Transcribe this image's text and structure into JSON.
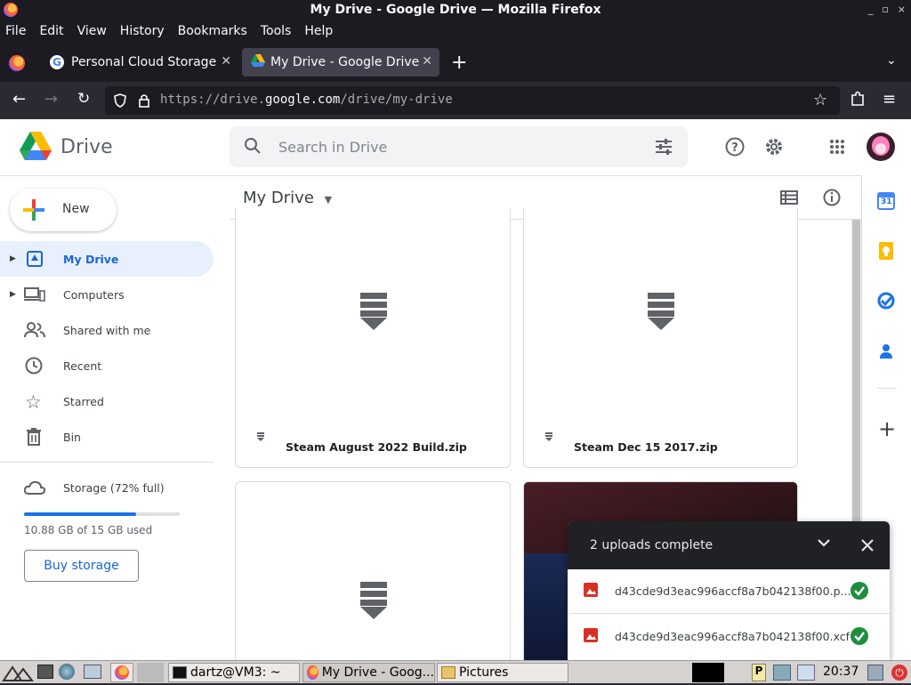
{
  "window": {
    "title": "My Drive - Google Drive — Mozilla Firefox",
    "controls": [
      "_",
      "▫",
      "×"
    ]
  },
  "menu": [
    "File",
    "Edit",
    "View",
    "History",
    "Bookmarks",
    "Tools",
    "Help"
  ],
  "tabs": [
    {
      "label": "Personal Cloud Storage &",
      "active": false
    },
    {
      "label": "My Drive - Google Drive",
      "active": true
    }
  ],
  "url": {
    "prefix": "https://drive.",
    "domain": "google.com",
    "path": "/drive/my-drive"
  },
  "drive": {
    "brand": "Drive",
    "search_placeholder": "Search in Drive",
    "new_label": "New",
    "header_title": "My Drive",
    "nav": [
      "My Drive",
      "Computers",
      "Shared with me",
      "Recent",
      "Starred",
      "Bin"
    ],
    "storage_label": "Storage (72% full)",
    "storage_used": "10.88 GB of 15 GB used",
    "storage_fraction": 0.72,
    "buy_storage": "Buy storage",
    "files": [
      {
        "name": "Steam August 2022 Build.zip"
      },
      {
        "name": "Steam Dec 15 2017.zip"
      }
    ],
    "calendar_day": "31"
  },
  "uploads": {
    "title": "2 uploads complete",
    "items": [
      {
        "name": "d43cde9d3eac996accf8a7b042138f00.p..."
      },
      {
        "name": "d43cde9d3eac996accf8a7b042138f00.xcf"
      }
    ]
  },
  "taskbar": {
    "terminal": "dartz@VM3: ~",
    "firefox": "My Drive - Goog...",
    "folder": "Pictures",
    "clock": "20:37"
  },
  "colors": {
    "accent": "#1967d2",
    "active_nav_bg": "#e8f0fe",
    "toast_bg": "#202124",
    "success": "#1e8e3e"
  }
}
